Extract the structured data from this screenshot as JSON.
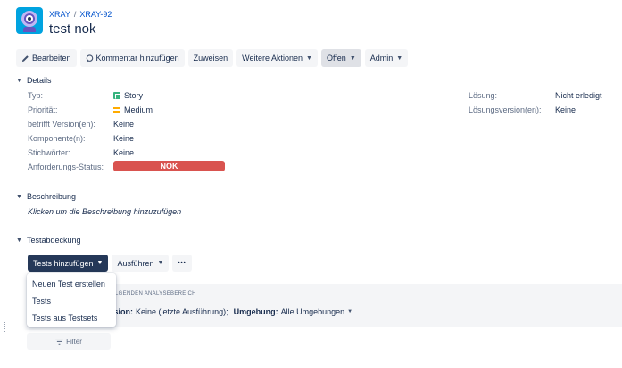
{
  "breadcrumb": {
    "project": "XRAY",
    "separator": "/",
    "issue_key": "XRAY-92"
  },
  "issue": {
    "title": "test nok"
  },
  "toolbar": {
    "edit": "Bearbeiten",
    "comment": "Kommentar hinzufügen",
    "assign": "Zuweisen",
    "more_actions": "Weitere Aktionen",
    "status": "Offen",
    "admin": "Admin"
  },
  "details": {
    "heading": "Details",
    "left": [
      {
        "label": "Typ:",
        "value": "Story",
        "icon": "story-icon"
      },
      {
        "label": "Priorität:",
        "value": "Medium",
        "icon": "priority-medium-icon"
      },
      {
        "label": "betrifft Version(en):",
        "value": "Keine"
      },
      {
        "label": "Komponente(n):",
        "value": "Keine"
      },
      {
        "label": "Stichwörter:",
        "value": "Keine"
      },
      {
        "label": "Anforderungs-Status:",
        "value": "NOK"
      }
    ],
    "right": [
      {
        "label": "Lösung:",
        "value": "Nicht erledigt"
      },
      {
        "label": "Lösungsversion(en):",
        "value": "Keine"
      }
    ],
    "status_color": "#d9534f"
  },
  "description": {
    "heading": "Beschreibung",
    "placeholder": "Klicken um die Beschreibung hinzuzufügen"
  },
  "coverage": {
    "heading": "Testabdeckung",
    "add_tests": "Tests hinzufügen",
    "execute": "Ausführen",
    "more": "•••",
    "dropdown": [
      "Neuen Test erstellen",
      "Tests",
      "Tests aus Testsets"
    ],
    "analysis_caption": "OLGENDEN ANALYSEBEREICH",
    "version_label": "rsion:",
    "version_value": "Keine (letzte Ausführung);",
    "env_label": "Umgebung:",
    "env_value": "Alle Umgebungen",
    "filter": "Filter"
  }
}
